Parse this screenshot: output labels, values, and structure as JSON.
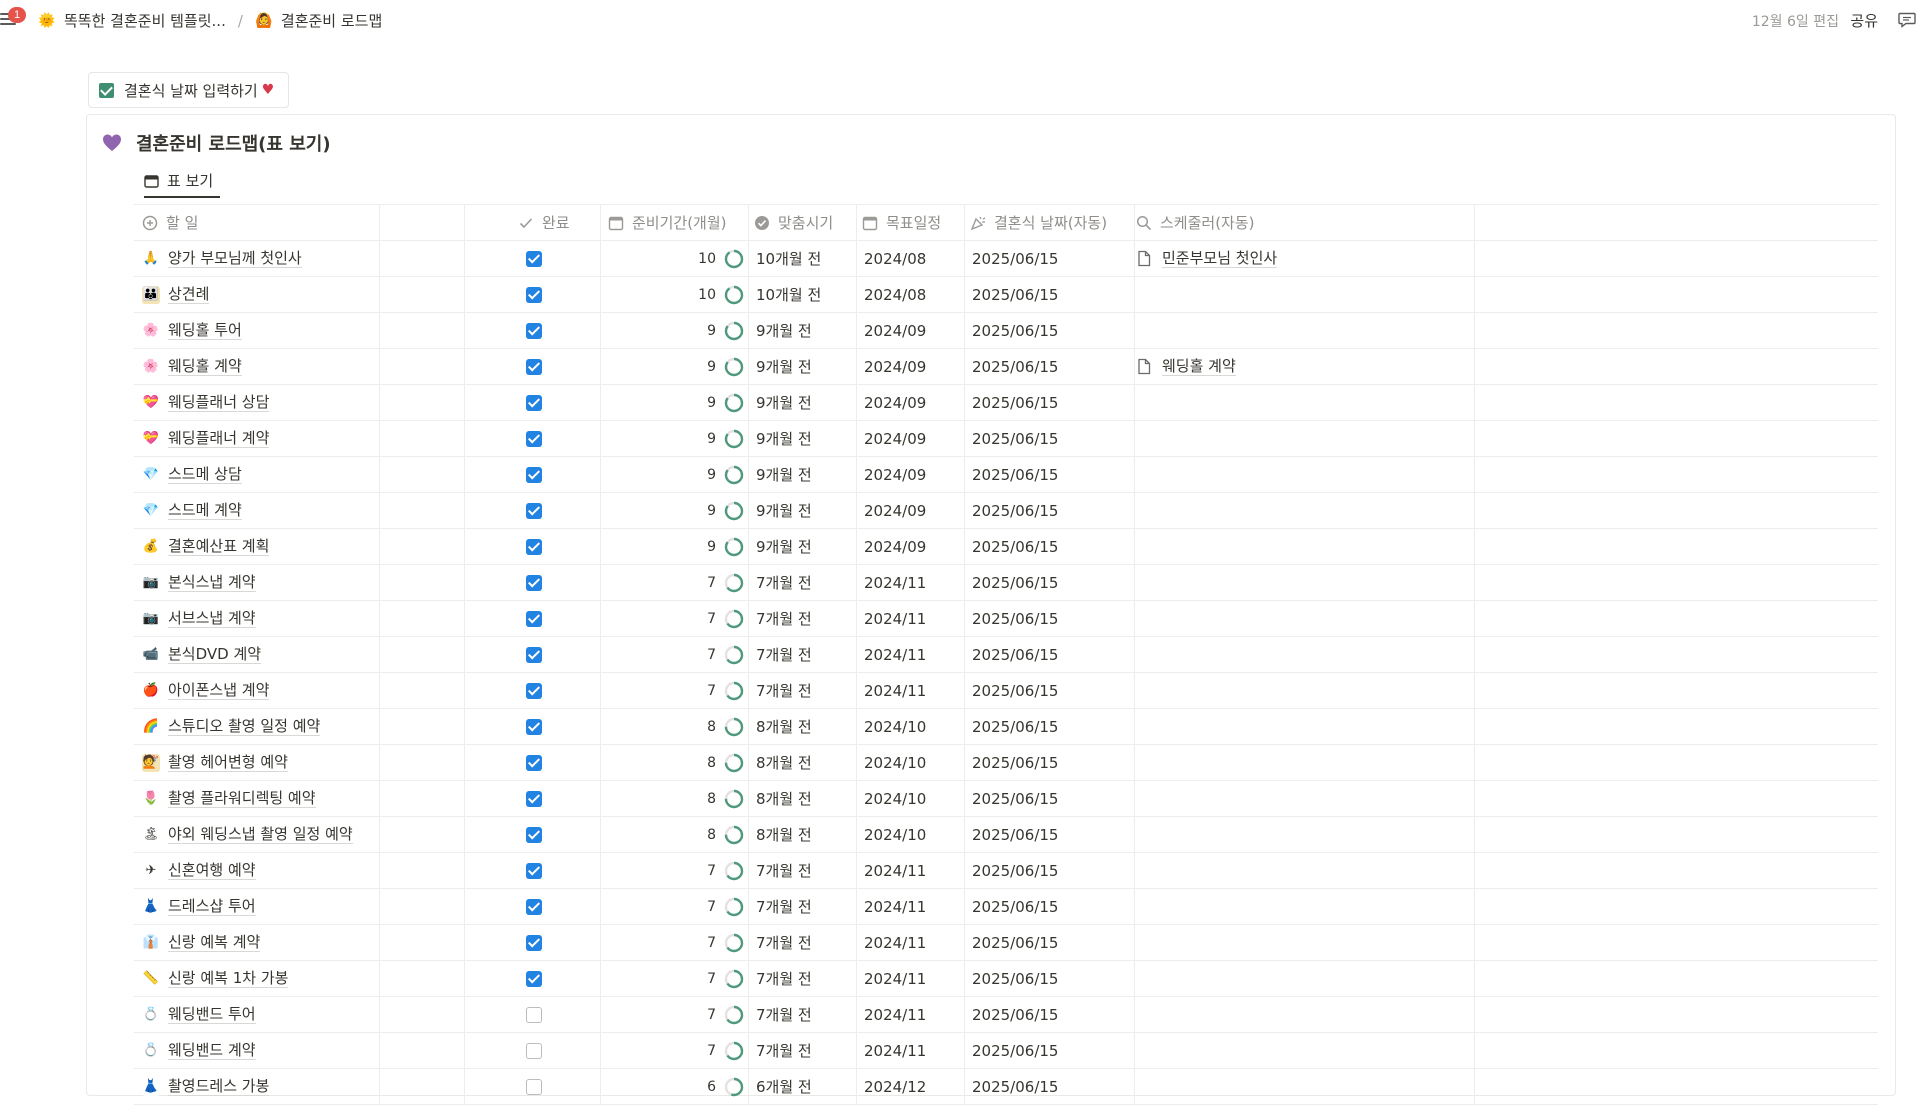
{
  "topbar": {
    "notification_count": "1",
    "breadcrumbs": [
      {
        "icon": "sun-emoji-icon",
        "label": "똑똑한 결혼준비 템플릿..."
      },
      {
        "icon": "person-emoji-icon",
        "label": "결혼준비 로드맵"
      }
    ],
    "separator": "/",
    "edited": "12월 6일 편집",
    "share": "공유"
  },
  "date_button": {
    "label": "결혼식 날짜 입력하기"
  },
  "database": {
    "title": "결혼준비 로드맵(표 보기)",
    "view_tab": "표 보기",
    "columns": {
      "task": "할 일",
      "done": "완료",
      "period": "준비기간(개월)",
      "timing": "맞춤시기",
      "target": "목표일정",
      "wedding": "결혼식 날짜(자동)",
      "scheduler": "스케줄러(자동)"
    },
    "rows": [
      {
        "icon": "🙏",
        "bg": "#ffffff",
        "task": "양가 부모님께 첫인사",
        "done": true,
        "period": "10",
        "progress": 0.9,
        "timing": "10개월 전",
        "target": "2024/08",
        "wedding": "2025/06/15",
        "scheduler": "민준부모님 첫인사"
      },
      {
        "icon": "👪",
        "bg": "#f4e3b3",
        "task": "상견례",
        "done": true,
        "period": "10",
        "progress": 0.9,
        "timing": "10개월 전",
        "target": "2024/08",
        "wedding": "2025/06/15",
        "scheduler": ""
      },
      {
        "icon": "🌸",
        "bg": "#ffffff",
        "task": "웨딩홀 투어",
        "done": true,
        "period": "9",
        "progress": 0.85,
        "timing": "9개월 전",
        "target": "2024/09",
        "wedding": "2025/06/15",
        "scheduler": ""
      },
      {
        "icon": "🌸",
        "bg": "#ffffff",
        "task": "웨딩홀 계약",
        "done": true,
        "period": "9",
        "progress": 0.85,
        "timing": "9개월 전",
        "target": "2024/09",
        "wedding": "2025/06/15",
        "scheduler": "웨딩홀 계약"
      },
      {
        "icon": "💝",
        "bg": "#ffffff",
        "task": "웨딩플래너 상담",
        "done": true,
        "period": "9",
        "progress": 0.85,
        "timing": "9개월 전",
        "target": "2024/09",
        "wedding": "2025/06/15",
        "scheduler": ""
      },
      {
        "icon": "💝",
        "bg": "#ffffff",
        "task": "웨딩플래너 계약",
        "done": true,
        "period": "9",
        "progress": 0.85,
        "timing": "9개월 전",
        "target": "2024/09",
        "wedding": "2025/06/15",
        "scheduler": ""
      },
      {
        "icon": "💎",
        "bg": "#ffffff",
        "task": "스드메 상담",
        "done": true,
        "period": "9",
        "progress": 0.85,
        "timing": "9개월 전",
        "target": "2024/09",
        "wedding": "2025/06/15",
        "scheduler": ""
      },
      {
        "icon": "💎",
        "bg": "#ffffff",
        "task": "스드메 계약",
        "done": true,
        "period": "9",
        "progress": 0.85,
        "timing": "9개월 전",
        "target": "2024/09",
        "wedding": "2025/06/15",
        "scheduler": ""
      },
      {
        "icon": "💰",
        "bg": "#ffffff",
        "task": "결혼예산표 계획",
        "done": true,
        "period": "9",
        "progress": 0.85,
        "timing": "9개월 전",
        "target": "2024/09",
        "wedding": "2025/06/15",
        "scheduler": ""
      },
      {
        "icon": "📷",
        "bg": "#ffffff",
        "task": "본식스냅 계약",
        "done": true,
        "period": "7",
        "progress": 0.65,
        "timing": "7개월 전",
        "target": "2024/11",
        "wedding": "2025/06/15",
        "scheduler": ""
      },
      {
        "icon": "📷",
        "bg": "#ffffff",
        "task": "서브스냅 계약",
        "done": true,
        "period": "7",
        "progress": 0.65,
        "timing": "7개월 전",
        "target": "2024/11",
        "wedding": "2025/06/15",
        "scheduler": ""
      },
      {
        "icon": "📹",
        "bg": "#ffffff",
        "task": "본식DVD 계약",
        "done": true,
        "period": "7",
        "progress": 0.65,
        "timing": "7개월 전",
        "target": "2024/11",
        "wedding": "2025/06/15",
        "scheduler": ""
      },
      {
        "icon": "🍎",
        "bg": "#ffffff",
        "task": "아이폰스냅 계약",
        "done": true,
        "period": "7",
        "progress": 0.65,
        "timing": "7개월 전",
        "target": "2024/11",
        "wedding": "2025/06/15",
        "scheduler": ""
      },
      {
        "icon": "🌈",
        "bg": "#ffffff",
        "task": "스튜디오 촬영 일정 예약",
        "done": true,
        "period": "8",
        "progress": 0.75,
        "timing": "8개월 전",
        "target": "2024/10",
        "wedding": "2025/06/15",
        "scheduler": ""
      },
      {
        "icon": "💇",
        "bg": "#f4e3b3",
        "task": "촬영 헤어변형 예약",
        "done": true,
        "period": "8",
        "progress": 0.75,
        "timing": "8개월 전",
        "target": "2024/10",
        "wedding": "2025/06/15",
        "scheduler": ""
      },
      {
        "icon": "🌷",
        "bg": "#ffffff",
        "task": "촬영 플라워디렉팅 예약",
        "done": true,
        "period": "8",
        "progress": 0.75,
        "timing": "8개월 전",
        "target": "2024/10",
        "wedding": "2025/06/15",
        "scheduler": ""
      },
      {
        "icon": "🏝",
        "bg": "#ffffff",
        "task": "야외 웨딩스냅 촬영 일정 예약",
        "done": true,
        "period": "8",
        "progress": 0.75,
        "timing": "8개월 전",
        "target": "2024/10",
        "wedding": "2025/06/15",
        "scheduler": ""
      },
      {
        "icon": "✈",
        "bg": "#ffffff",
        "task": "신혼여행 예약",
        "done": true,
        "period": "7",
        "progress": 0.65,
        "timing": "7개월 전",
        "target": "2024/11",
        "wedding": "2025/06/15",
        "scheduler": ""
      },
      {
        "icon": "👗",
        "bg": "#ffffff",
        "task": "드레스샵 투어",
        "done": true,
        "period": "7",
        "progress": 0.65,
        "timing": "7개월 전",
        "target": "2024/11",
        "wedding": "2025/06/15",
        "scheduler": ""
      },
      {
        "icon": "👔",
        "bg": "#ffffff",
        "task": "신랑 예복 계약",
        "done": true,
        "period": "7",
        "progress": 0.65,
        "timing": "7개월 전",
        "target": "2024/11",
        "wedding": "2025/06/15",
        "scheduler": ""
      },
      {
        "icon": "📏",
        "bg": "#ffffff",
        "task": "신랑 예복 1차 가봉",
        "done": true,
        "period": "7",
        "progress": 0.65,
        "timing": "7개월 전",
        "target": "2024/11",
        "wedding": "2025/06/15",
        "scheduler": ""
      },
      {
        "icon": "💍",
        "bg": "#ffffff",
        "task": "웨딩밴드 투어",
        "done": false,
        "period": "7",
        "progress": 0.65,
        "timing": "7개월 전",
        "target": "2024/11",
        "wedding": "2025/06/15",
        "scheduler": ""
      },
      {
        "icon": "💍",
        "bg": "#ffffff",
        "task": "웨딩밴드 계약",
        "done": false,
        "period": "7",
        "progress": 0.65,
        "timing": "7개월 전",
        "target": "2024/11",
        "wedding": "2025/06/15",
        "scheduler": ""
      },
      {
        "icon": "👗",
        "bg": "#ffffff",
        "task": "촬영드레스 가봉",
        "done": false,
        "period": "6",
        "progress": 0.55,
        "timing": "6개월 전",
        "target": "2024/12",
        "wedding": "2025/06/15",
        "scheduler": ""
      }
    ]
  },
  "colors": {
    "accent": "#2383e2",
    "ring": "#4f9a7d",
    "heart": "#9065b0"
  }
}
